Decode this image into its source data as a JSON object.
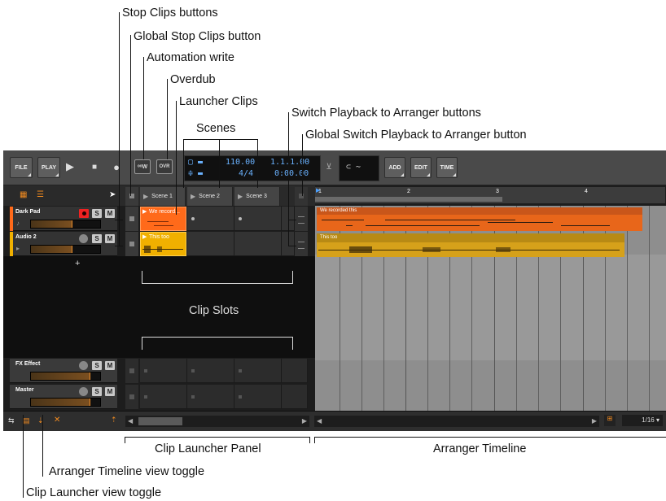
{
  "callouts": {
    "stop_clips": "Stop Clips buttons",
    "global_stop": "Global Stop Clips button",
    "automation_write": "Automation write",
    "overdub": "Overdub",
    "launcher_clips": "Launcher Clips",
    "scenes": "Scenes",
    "switch_playback": "Switch Playback to Arranger buttons",
    "global_switch": "Global Switch Playback to Arranger button",
    "clip_slots": "Clip Slots",
    "clip_launcher_panel": "Clip Launcher Panel",
    "arranger_timeline": "Arranger Timeline",
    "arranger_toggle": "Arranger Timeline view toggle",
    "clip_launcher_toggle": "Clip Launcher view toggle"
  },
  "toolbar": {
    "file": "FILE",
    "play": "PLAY",
    "add": "ADD",
    "edit": "EDIT",
    "time": "TIME",
    "automation_write_label": "⁰W",
    "overdub_label": "OVR",
    "tempo": "110.00",
    "signature": "4/4",
    "position": "1.1.1.00",
    "time_position": "0:00.00"
  },
  "scenes": [
    "Scene 1",
    "Scene 2",
    "Scene 3"
  ],
  "tracks": [
    {
      "name": "Dark Pad",
      "color": "#ff6a1a",
      "s": "S",
      "m": "M"
    },
    {
      "name": "Audio 2",
      "color": "#f0b000",
      "s": "S",
      "m": "M"
    },
    {
      "name": "FX Effect",
      "color": "#4a4a4a",
      "s": "S",
      "m": "M"
    },
    {
      "name": "Master",
      "color": "#4a4a4a",
      "s": "S",
      "m": "M"
    }
  ],
  "launcher_clips": [
    "We record...",
    "This too"
  ],
  "arranger_clips": [
    "We recorded this",
    "This too"
  ],
  "ruler": [
    "1",
    "2",
    "3",
    "4"
  ],
  "grid_value": "1/16",
  "colors": {
    "orange": "#ff6a1a",
    "yellow": "#f0b000",
    "lcd": "#6ab2ff"
  }
}
